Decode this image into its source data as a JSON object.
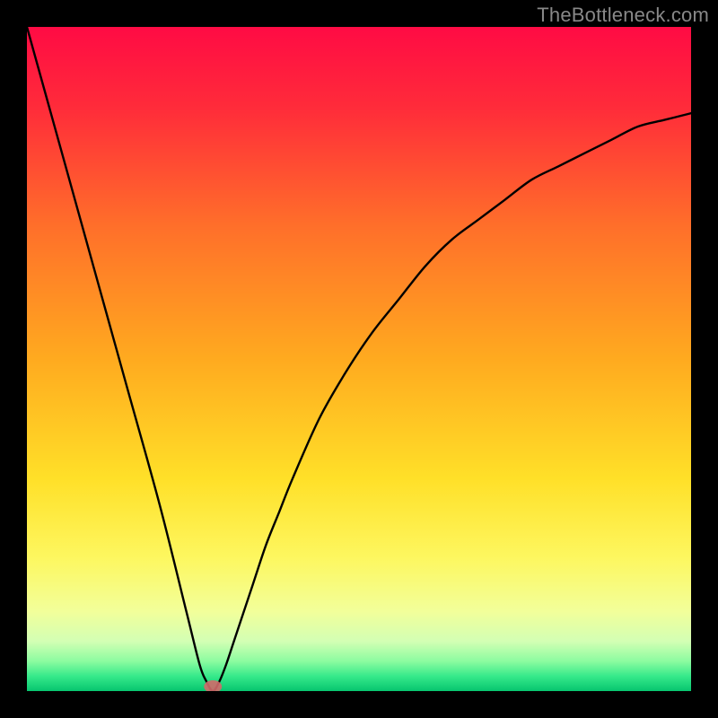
{
  "watermark": "TheBottleneck.com",
  "chart_data": {
    "type": "line",
    "title": "",
    "xlabel": "",
    "ylabel": "",
    "xlim": [
      0,
      100
    ],
    "ylim": [
      0,
      100
    ],
    "grid": false,
    "legend": false,
    "series": [
      {
        "name": "bottleneck-curve",
        "x": [
          0,
          5,
          10,
          15,
          20,
          24,
          26,
          27,
          28,
          29,
          30,
          31,
          32,
          34,
          36,
          38,
          40,
          44,
          48,
          52,
          56,
          60,
          64,
          68,
          72,
          76,
          80,
          84,
          88,
          92,
          96,
          100
        ],
        "y": [
          100,
          82,
          64,
          46,
          28,
          12,
          4,
          1.5,
          0,
          1.5,
          4,
          7,
          10,
          16,
          22,
          27,
          32,
          41,
          48,
          54,
          59,
          64,
          68,
          71,
          74,
          77,
          79,
          81,
          83,
          85,
          86,
          87
        ]
      }
    ],
    "markers": [
      {
        "name": "optimal-point-marker",
        "x": 28,
        "y": 0,
        "color": "#d16a6a"
      }
    ],
    "background_gradient": {
      "type": "vertical",
      "stops": [
        {
          "offset": 0.0,
          "color": "#ff0b44"
        },
        {
          "offset": 0.12,
          "color": "#ff2b3a"
        },
        {
          "offset": 0.3,
          "color": "#ff6f2a"
        },
        {
          "offset": 0.5,
          "color": "#ffaa1f"
        },
        {
          "offset": 0.68,
          "color": "#ffe028"
        },
        {
          "offset": 0.8,
          "color": "#fdf760"
        },
        {
          "offset": 0.88,
          "color": "#f2ff9a"
        },
        {
          "offset": 0.925,
          "color": "#d3ffb4"
        },
        {
          "offset": 0.955,
          "color": "#8cfca0"
        },
        {
          "offset": 0.978,
          "color": "#35e98a"
        },
        {
          "offset": 1.0,
          "color": "#07c56f"
        }
      ]
    }
  }
}
